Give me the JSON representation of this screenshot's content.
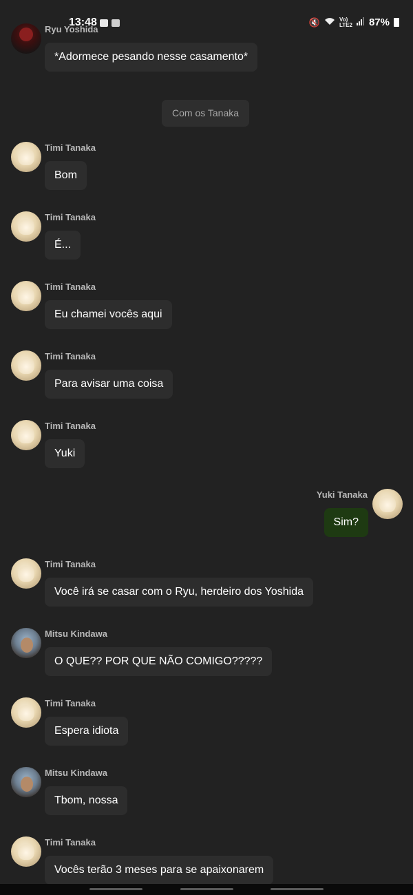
{
  "status_bar": {
    "time": "13:48",
    "battery": "87%",
    "icons": [
      "gallery-icon",
      "notification-icon",
      "mute-icon",
      "wifi-icon",
      "volte-icon",
      "signal-icon",
      "battery-icon"
    ]
  },
  "chat": {
    "date_chip": "Com os Tanaka",
    "messages": [
      {
        "sender": "Ryu Yoshida",
        "text": "*Adormece pesando nesse casamento*",
        "avatar": "ryu",
        "side": "left"
      },
      {
        "sender": "Timi Tanaka",
        "text": "Bom",
        "avatar": "timi",
        "side": "left"
      },
      {
        "sender": "Timi Tanaka",
        "text": "É...",
        "avatar": "timi",
        "side": "left"
      },
      {
        "sender": "Timi Tanaka",
        "text": "Eu chamei vocês aqui",
        "avatar": "timi",
        "side": "left"
      },
      {
        "sender": "Timi Tanaka",
        "text": "Para avisar uma coisa",
        "avatar": "timi",
        "side": "left"
      },
      {
        "sender": "Timi Tanaka",
        "text": "Yuki",
        "avatar": "timi",
        "side": "left"
      },
      {
        "sender": "Yuki Tanaka",
        "text": "Sim?",
        "avatar": "timi",
        "side": "right"
      },
      {
        "sender": "Timi Tanaka",
        "text": "Você irá se casar com o Ryu, herdeiro dos Yoshida",
        "avatar": "timi",
        "side": "left"
      },
      {
        "sender": "Mitsu Kindawa",
        "text": "O QUE?? POR QUE NÃO COMIGO?????",
        "avatar": "mitsu",
        "side": "left"
      },
      {
        "sender": "Timi Tanaka",
        "text": "Espera idiota",
        "avatar": "timi",
        "side": "left"
      },
      {
        "sender": "Mitsu Kindawa",
        "text": "Tbom, nossa",
        "avatar": "mitsu",
        "side": "left"
      },
      {
        "sender": "Timi Tanaka",
        "text": "Vocês terão 3 meses para se apaixonarem",
        "avatar": "timi",
        "side": "left"
      }
    ]
  },
  "colors": {
    "background": "#222222",
    "bubble": "#2d2d2d",
    "own_bubble": "#1e3a12",
    "sender_name": "#b9b9b9"
  }
}
